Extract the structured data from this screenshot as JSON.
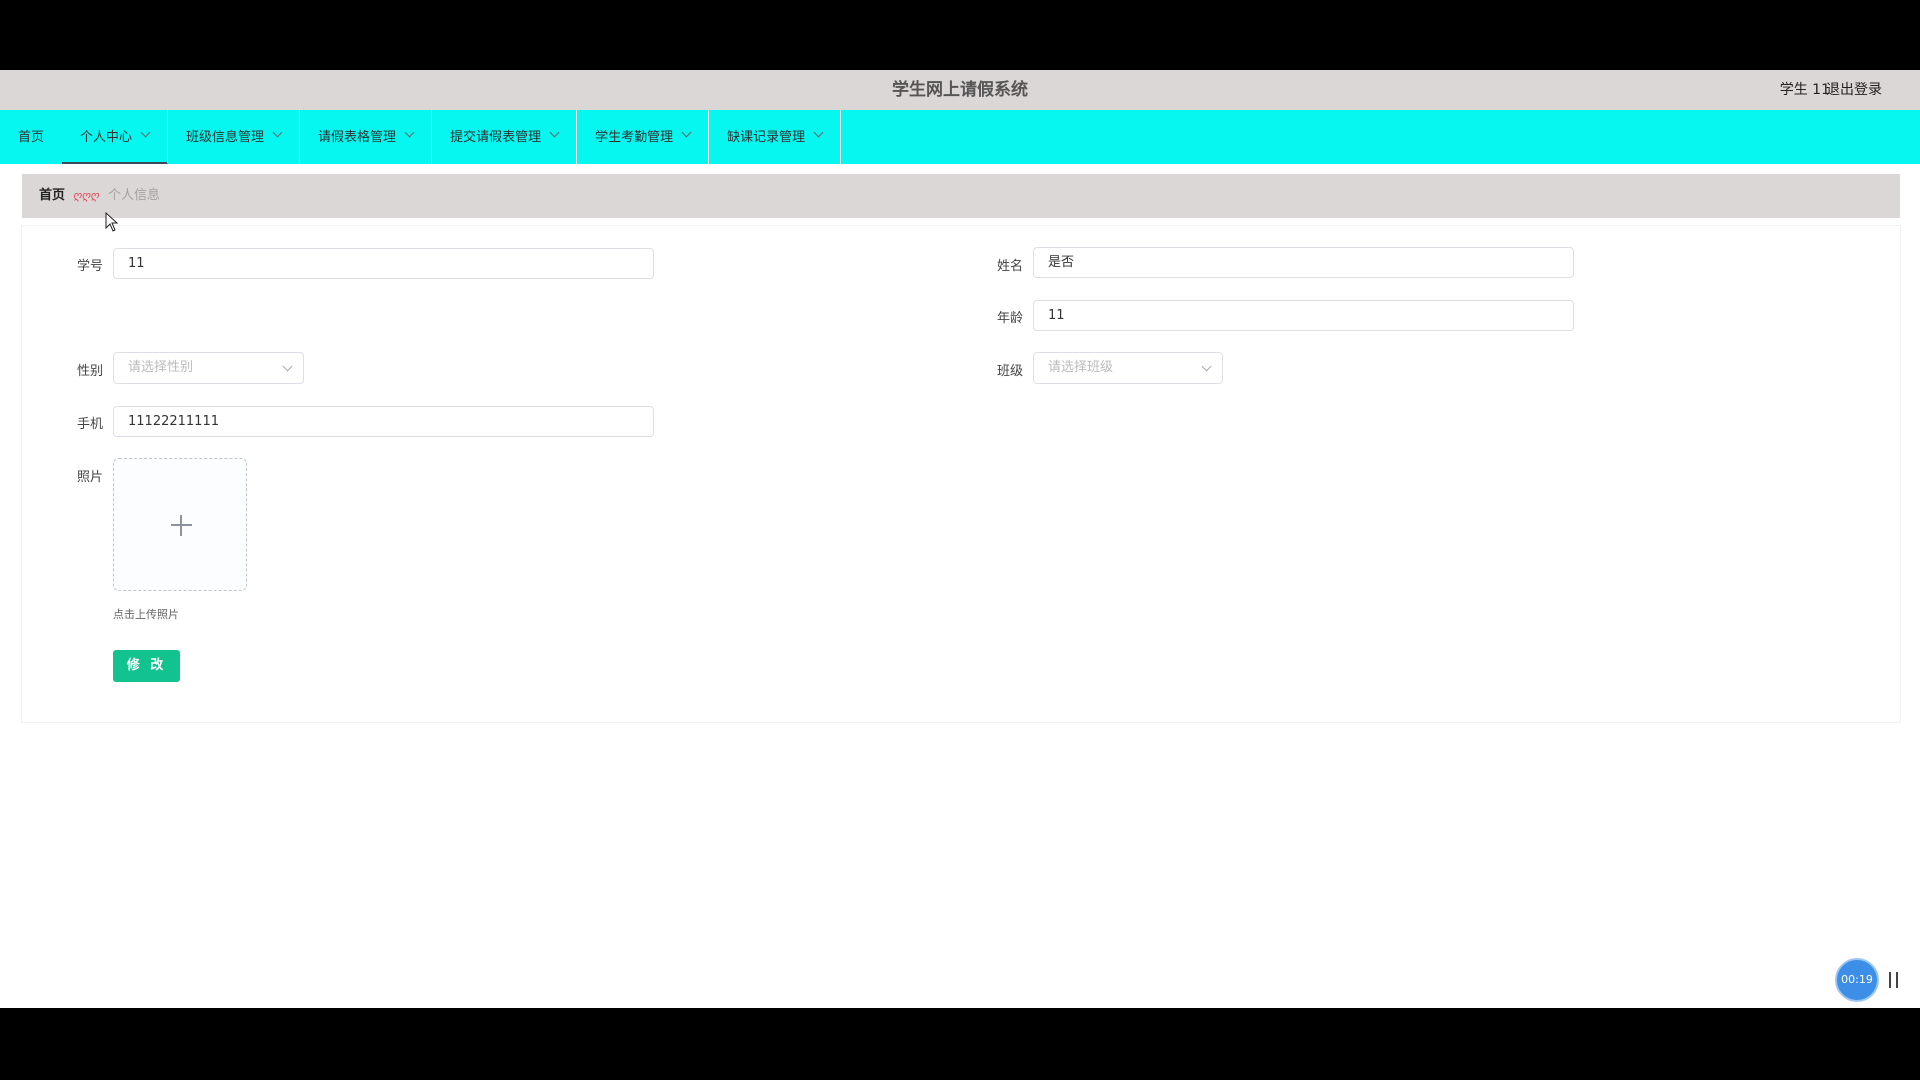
{
  "header": {
    "title": "学生网上请假系统",
    "user": "学生 11",
    "logout": "退出登录"
  },
  "nav": {
    "home": "首页",
    "items": [
      "个人中心",
      "班级信息管理",
      "请假表格管理",
      "提交请假表管理",
      "学生考勤管理",
      "缺课记录管理"
    ],
    "active": "个人中心"
  },
  "breadcrumb": {
    "home": "首页",
    "separator": "ღღღ",
    "current": "个人信息"
  },
  "form": {
    "student_id_label": "学号",
    "student_id_value": "11",
    "name_label": "姓名",
    "name_value": "是否",
    "age_label": "年龄",
    "age_value": "11",
    "gender_label": "性别",
    "gender_placeholder": "请选择性别",
    "class_label": "班级",
    "class_placeholder": "请选择班级",
    "phone_label": "手机",
    "phone_value": "11122211111",
    "photo_label": "照片",
    "photo_hint": "点击上传照片",
    "submit_label": "修 改"
  },
  "recorder": {
    "time": "00:19"
  },
  "colors": {
    "nav_bg": "#05f7ef",
    "header_bg": "#dcd7d7",
    "submit_bg": "#13c38f",
    "recorder_bg": "#3c8ee6"
  },
  "icons": [
    "chevron-down-icon",
    "plus-icon",
    "pause-icon",
    "mouse-cursor-icon"
  ]
}
